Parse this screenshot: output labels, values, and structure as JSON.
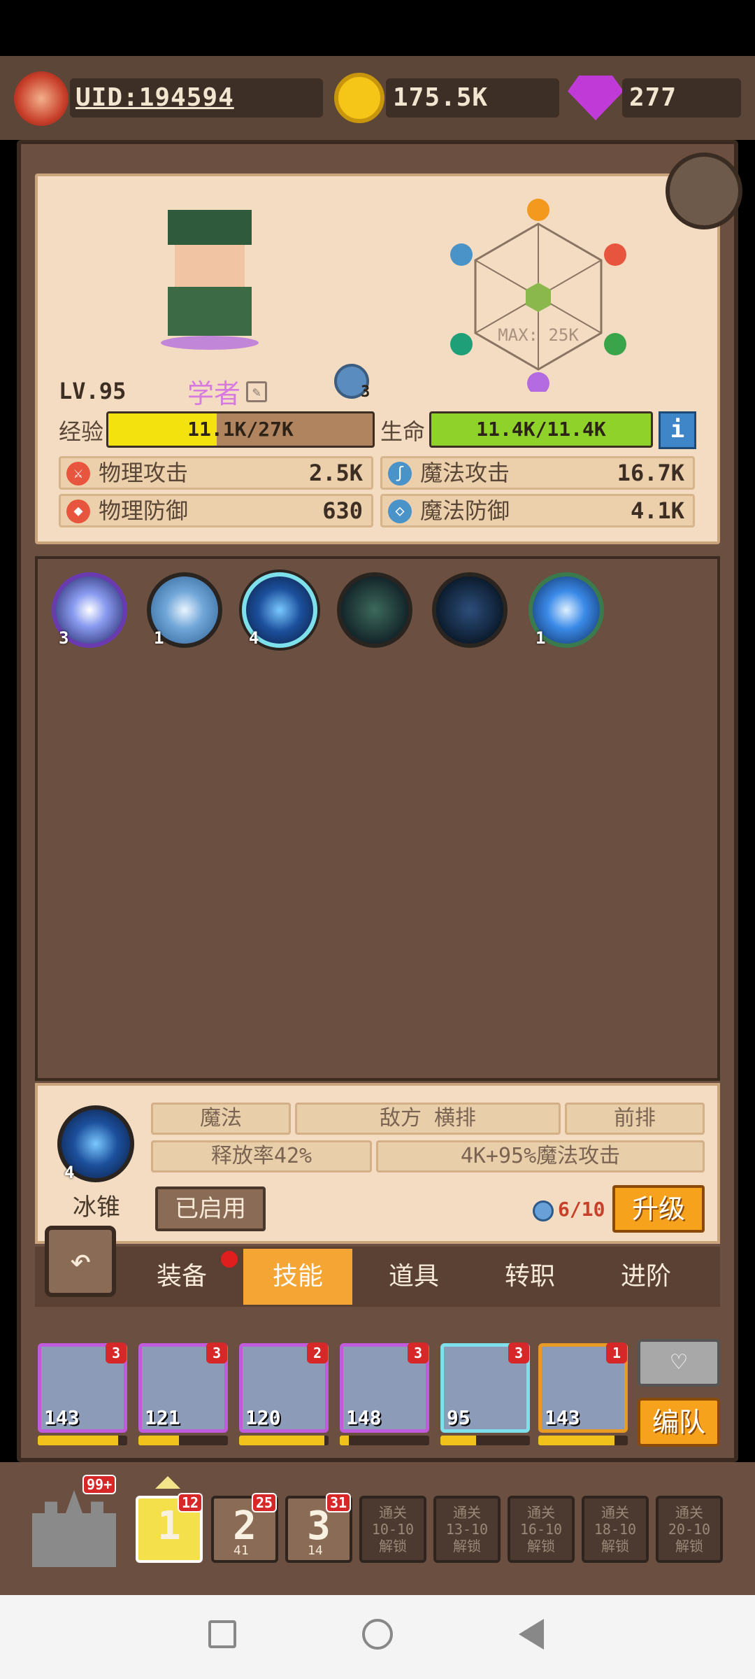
{
  "top": {
    "uid": "UID:194594",
    "gold": "175.5K",
    "gems": "277"
  },
  "hero": {
    "level": "LV.95",
    "class": "学者",
    "exp_label": "经验",
    "exp_text": "11.1K/27K",
    "exp_fraction": 0.41,
    "hp_label": "生命",
    "hp_text": "11.4K/11.4K",
    "hp_fraction": 1.0,
    "vision_count": "3",
    "radar_max": "MAX: 25K",
    "stats": [
      {
        "label": "物理攻击",
        "value": "2.5K",
        "icon": "sword-icon"
      },
      {
        "label": "魔法攻击",
        "value": "16.7K",
        "icon": "staff-icon"
      },
      {
        "label": "物理防御",
        "value": "630",
        "icon": "shield-icon"
      },
      {
        "label": "魔法防御",
        "value": "4.1K",
        "icon": "magic-shield-icon"
      }
    ]
  },
  "skills": [
    {
      "icon": "star-burst-icon",
      "level": "3"
    },
    {
      "icon": "staff-icon",
      "level": "1"
    },
    {
      "icon": "ice-cone-icon",
      "level": "4"
    },
    {
      "icon": "dark-leaf-icon",
      "level": ""
    },
    {
      "icon": "dark-comet-icon",
      "level": ""
    },
    {
      "icon": "blue-comet-icon",
      "level": "1"
    }
  ],
  "skill_detail": {
    "name": "冰锥",
    "level": "4",
    "type": "魔法",
    "target": "敌方 横排",
    "row": "前排",
    "cast_rate": "释放率42%",
    "damage": "4K+95%魔法攻击",
    "status_button": "已启用",
    "cost": "6/10",
    "upgrade_button": "升级"
  },
  "tabs": [
    {
      "label": "装备",
      "active": false
    },
    {
      "label": "技能",
      "active": true
    },
    {
      "label": "道具",
      "active": false
    },
    {
      "label": "转职",
      "active": false
    },
    {
      "label": "进阶",
      "active": false
    }
  ],
  "team": [
    {
      "level": "143",
      "badge": "3",
      "exp_fraction": 0.9
    },
    {
      "level": "121",
      "badge": "3",
      "exp_fraction": 0.45
    },
    {
      "level": "120",
      "badge": "2",
      "exp_fraction": 0.95
    },
    {
      "level": "148",
      "badge": "3",
      "exp_fraction": 0.1
    },
    {
      "level": "95",
      "badge": "3",
      "exp_fraction": 0.4
    },
    {
      "level": "143",
      "badge": "1",
      "exp_fraction": 0.85
    }
  ],
  "team_button": "编队",
  "bottom": {
    "castle_badge": "99+",
    "slots": [
      {
        "label": "1",
        "badge": "12",
        "sub": ""
      },
      {
        "label": "2",
        "badge": "25",
        "sub": "41"
      },
      {
        "label": "3",
        "badge": "31",
        "sub": "14"
      },
      {
        "label": "通关\n10-10\n解锁"
      },
      {
        "label": "通关\n13-10\n解锁"
      },
      {
        "label": "通关\n16-10\n解锁"
      },
      {
        "label": "通关\n18-10\n解锁"
      },
      {
        "label": "通关\n20-10\n解锁"
      }
    ]
  }
}
